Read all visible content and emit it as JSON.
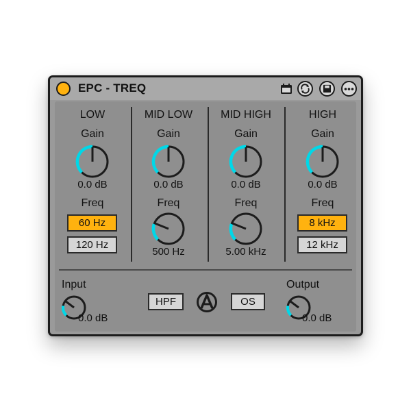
{
  "device": {
    "title": "EPC - TREQ",
    "icons": [
      "calendar-icon",
      "sync-icon",
      "save-icon",
      "more-icon"
    ],
    "colors": {
      "accent_on": "#ffb20f",
      "knob_arc": "#00d8e8",
      "panel": "#8f8f8f"
    }
  },
  "bands": [
    {
      "name": "LOW",
      "gain_label": "Gain",
      "gain_value": "0.0 dB",
      "freq_label": "Freq",
      "options": [
        {
          "label": "60 Hz",
          "selected": true
        },
        {
          "label": "120 Hz",
          "selected": false
        }
      ]
    },
    {
      "name": "MID LOW",
      "gain_label": "Gain",
      "gain_value": "0.0 dB",
      "freq_label": "Freq",
      "freq_value": "500 Hz"
    },
    {
      "name": "MID HIGH",
      "gain_label": "Gain",
      "gain_value": "0.0 dB",
      "freq_label": "Freq",
      "freq_value": "5.00 kHz"
    },
    {
      "name": "HIGH",
      "gain_label": "Gain",
      "gain_value": "0.0 dB",
      "freq_label": "Freq",
      "options": [
        {
          "label": "8 kHz",
          "selected": true
        },
        {
          "label": "12 kHz",
          "selected": false
        }
      ]
    }
  ],
  "footer": {
    "input_label": "Input",
    "input_value": "0.0 dB",
    "hpf_label": "HPF",
    "os_label": "OS",
    "output_label": "Output",
    "output_value": "0.0 dB"
  }
}
